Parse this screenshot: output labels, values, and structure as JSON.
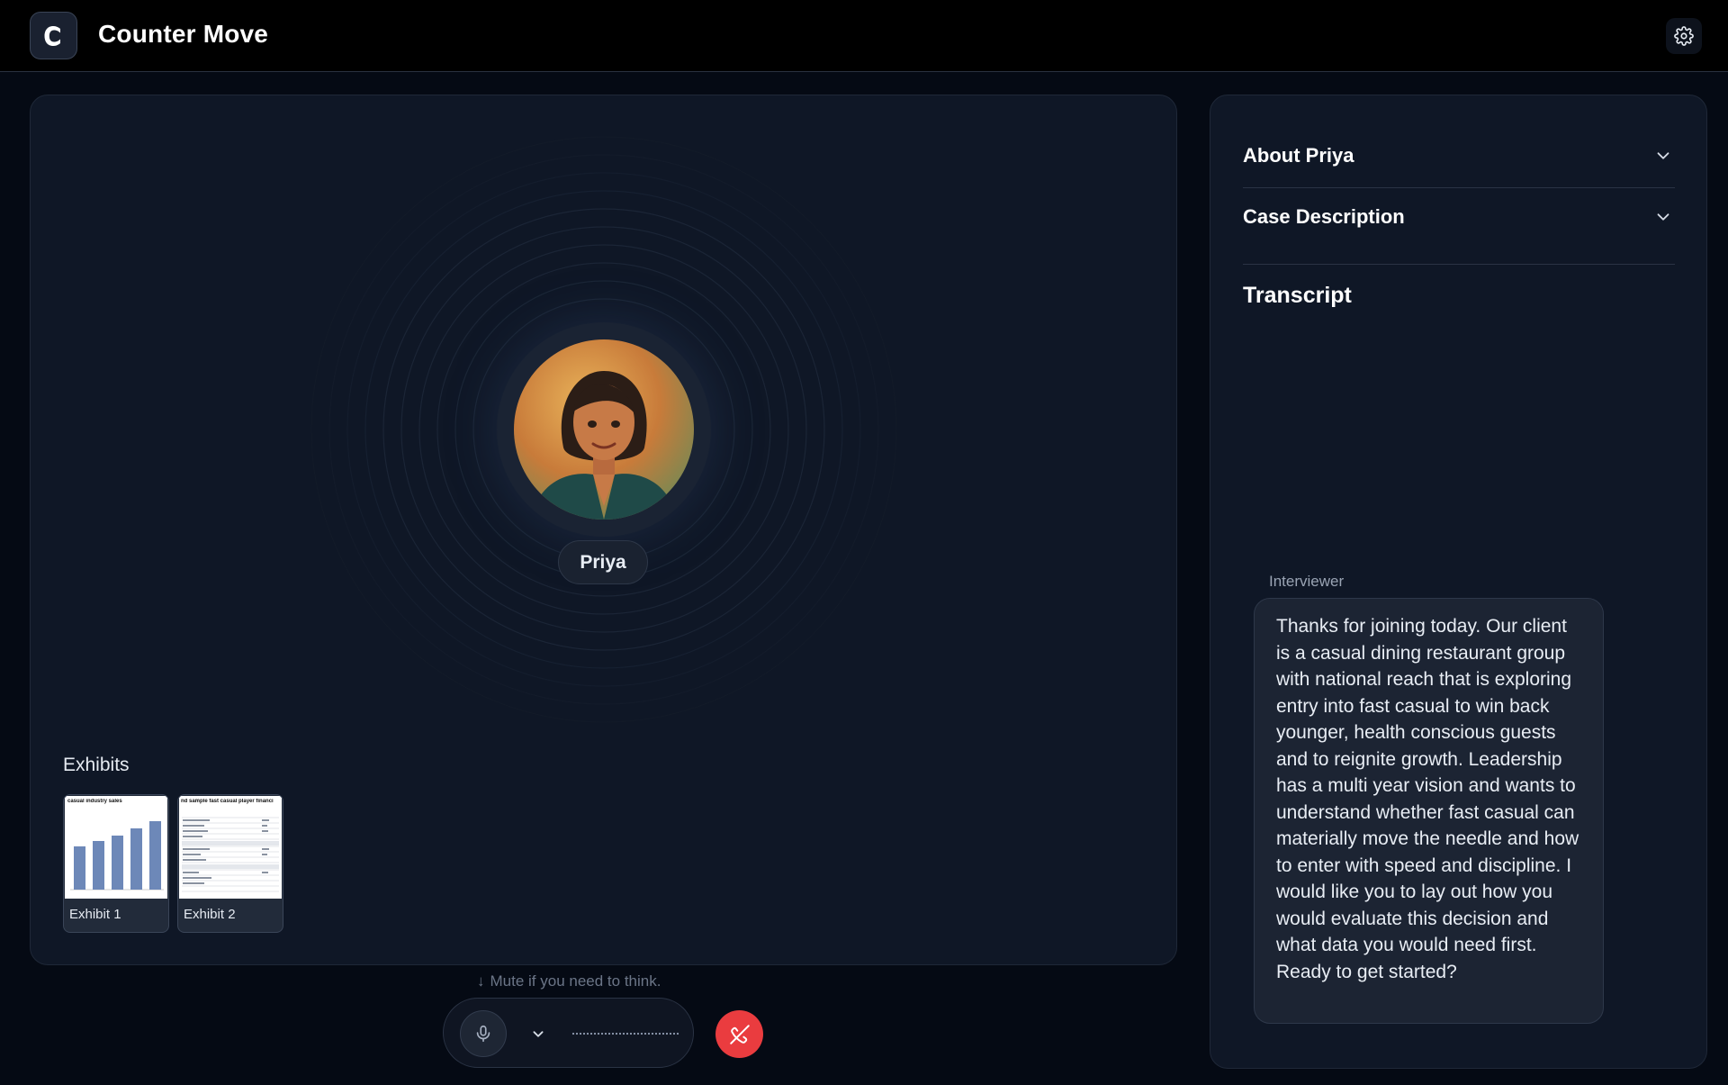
{
  "app": {
    "name": "Counter Move",
    "logo_letter": "C"
  },
  "header": {
    "settings_icon": "gear-icon"
  },
  "interviewer_panel": {
    "persona_name": "Priya",
    "exhibits_label": "Exhibits",
    "exhibits": [
      {
        "label": "Exhibit 1",
        "thumb_title": "casual industry sales"
      },
      {
        "label": "Exhibit 2",
        "thumb_title": "nd sample fast casual player financi"
      }
    ]
  },
  "call_controls": {
    "hint": "Mute if you need to think.",
    "mic_icon": "microphone-icon",
    "device_icon": "chevron-down-icon",
    "hangup_icon": "phone-hangup-icon",
    "hangup_color": "#ea3c3f"
  },
  "sidebar": {
    "accordions": [
      {
        "label": "About Priya"
      },
      {
        "label": "Case Description"
      }
    ],
    "transcript_title": "Transcript",
    "messages": [
      {
        "speaker": "Interviewer",
        "text": "Thanks for joining today. Our client is a casual dining restaurant group with national reach that is exploring entry into fast casual to win back younger, health conscious guests and to reignite growth. Leadership has a multi year vision and wants to understand whether fast casual can materially move the needle and how to enter with speed and discipline. I would like you to lay out how you would evaluate this decision and what data you would need first. Ready to get started?"
      }
    ]
  },
  "colors": {
    "background": "#050a14",
    "panel": "#0f1726",
    "accent_danger": "#ea3c3f"
  }
}
